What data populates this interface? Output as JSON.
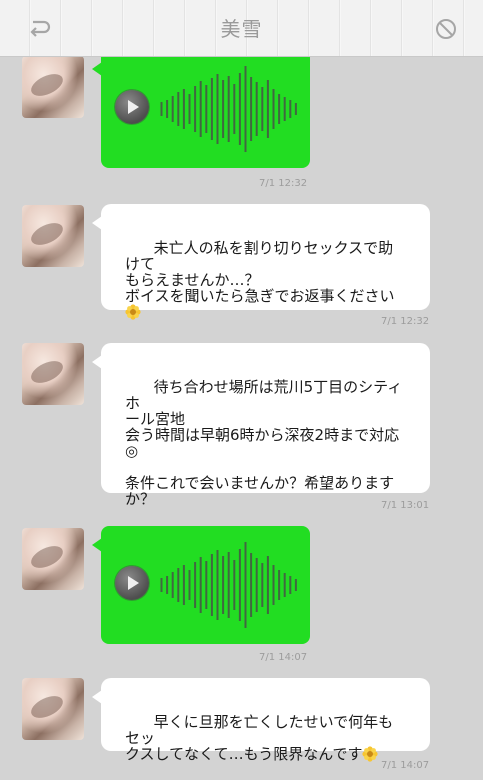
{
  "header": {
    "title": "美雪",
    "back_icon": "back-arrow-icon",
    "block_icon": "block-icon"
  },
  "messages": [
    {
      "type": "voice",
      "timestamp": "7/1 12:32"
    },
    {
      "type": "text",
      "text": "未亡人の私を割り切りセックスで助けて\nもらえませんか…？\nボイスを聞いたら急ぎでお返事ください",
      "emoji": "flower-icon",
      "timestamp": "7/1 12:32"
    },
    {
      "type": "text",
      "text": "待ち合わせ場所は荒川5丁目のシティホ\nール宮地\n会う時間は早朝6時から深夜2時まで対応\n◎\n\n条件これで会いませんか？希望あります\nか？",
      "timestamp": "7/1 13:01"
    },
    {
      "type": "voice",
      "timestamp": "7/1 14:07"
    },
    {
      "type": "text",
      "text": "早くに旦那を亡くしたせいで何年もセッ\nクスしてなくて…もう限界なんです",
      "emoji": "flower-icon",
      "timestamp": "7/1 14:07"
    }
  ],
  "colors": {
    "background": "#d3d3d3",
    "voice_bubble": "#22dd22",
    "text_bubble": "#ffffff",
    "timestamp": "#9c9c9c"
  }
}
